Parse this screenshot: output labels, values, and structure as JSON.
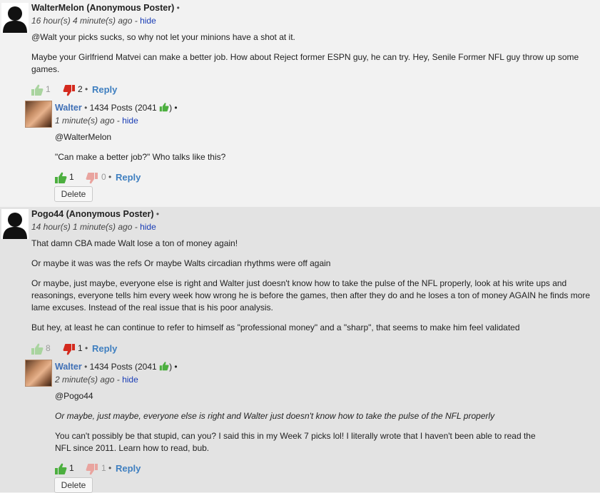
{
  "comment1": {
    "author": "WalterMelon (Anonymous Poster)",
    "time": "16 hour(s) 4 minute(s) ago",
    "hide": "hide",
    "paragraphs": [
      "@Walt your picks sucks, so why not let your minions have a shot at it.",
      "Maybe your Girlfriend Matvei can make a better job. How about Reject former ESPN guy, he can try. Hey, Senile Former NFL guy throw up some games."
    ],
    "likes": "1",
    "dislikes": "2",
    "reply": "Reply",
    "reply_comment": {
      "author": "Walter",
      "posts": "1434 Posts (2041",
      "time": "1 minute(s) ago",
      "hide": "hide",
      "paragraphs": [
        "@WalterMelon",
        "\"Can make a better job?\" Who talks like this?"
      ],
      "likes": "1",
      "dislikes": "0",
      "reply": "Reply",
      "delete": "Delete"
    }
  },
  "comment2": {
    "author": "Pogo44 (Anonymous Poster)",
    "time": "14 hour(s) 1 minute(s) ago",
    "hide": "hide",
    "paragraphs": [
      "That damn CBA made Walt lose a ton of money again!",
      "Or maybe it was was the refs Or maybe Walts circadian rhythms were off again",
      "Or maybe, just maybe, everyone else is right and Walter just doesn't know how to take the pulse of the NFL properly, look at his write ups and reasonings, everyone tells him every week how wrong he is before the games, then after they do and he loses a ton of money AGAIN he finds more lame excuses. Instead of the real issue that is his poor analysis.",
      "But hey, at least he can continue to refer to himself as \"professional money\" and a \"sharp\", that seems to make him feel validated"
    ],
    "likes": "8",
    "dislikes": "1",
    "reply": "Reply",
    "reply_comment": {
      "author": "Walter",
      "posts": "1434 Posts (2041",
      "time": "2 minute(s) ago",
      "hide": "hide",
      "paragraphs": [
        "@Pogo44",
        "Or maybe, just maybe, everyone else is right and Walter just doesn't know how to take the pulse of the NFL properly",
        "You can't possibly be that stupid, can you? I said this in my Week 7 picks lol! I literally wrote that I haven't been able to read the NFL since 2011. Learn how to read, bub."
      ],
      "likes": "1",
      "dislikes": "1",
      "reply": "Reply",
      "delete": "Delete"
    }
  },
  "icons": {
    "like": "thumbs-up-icon",
    "dislike": "thumbs-down-icon",
    "anon_avatar": "anonymous-avatar",
    "user_avatar": "user-avatar"
  },
  "colors": {
    "like_active": "#4caf3f",
    "like_inactive": "#a9d49f",
    "dislike_active": "#d42a1e",
    "dislike_inactive": "#e9a49f",
    "reply": "#3f7fc0",
    "hide": "#1a3db5"
  }
}
